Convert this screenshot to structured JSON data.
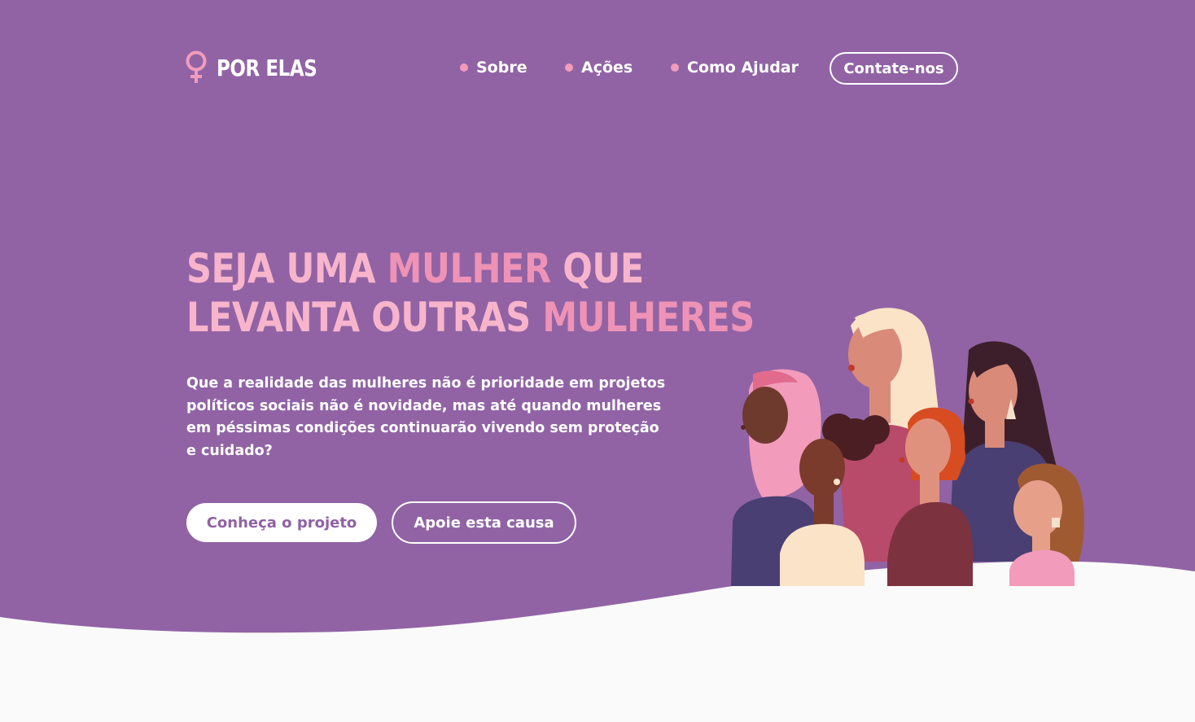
{
  "header": {
    "logo_text": "POR ELAS",
    "logo_icon": "female-symbol-icon",
    "nav": [
      {
        "label": "Sobre"
      },
      {
        "label": "Ações"
      },
      {
        "label": "Como Ajudar"
      }
    ],
    "contact_label": "Contate-nos"
  },
  "hero": {
    "headline": {
      "line1": {
        "a": "SEJA UMA ",
        "accent": "MULHER",
        "b": " QUE"
      },
      "line2": {
        "a": "LEVANTA OUTRAS ",
        "accent": "MULHERES"
      }
    },
    "lead": "Que a realidade das mulheres não é prioridade em projetos políticos sociais não é novidade, mas até quando mulheres em péssimas condições continuarão vivendo sem proteção e cuidado?",
    "primary_button": "Conheça o projeto",
    "secondary_button": "Apoie esta causa",
    "illustration": "group-of-diverse-women-illustration"
  },
  "colors": {
    "hero_background": "#9163a5",
    "accent_pink": "#f29bbb",
    "page_background": "#fafafa"
  }
}
